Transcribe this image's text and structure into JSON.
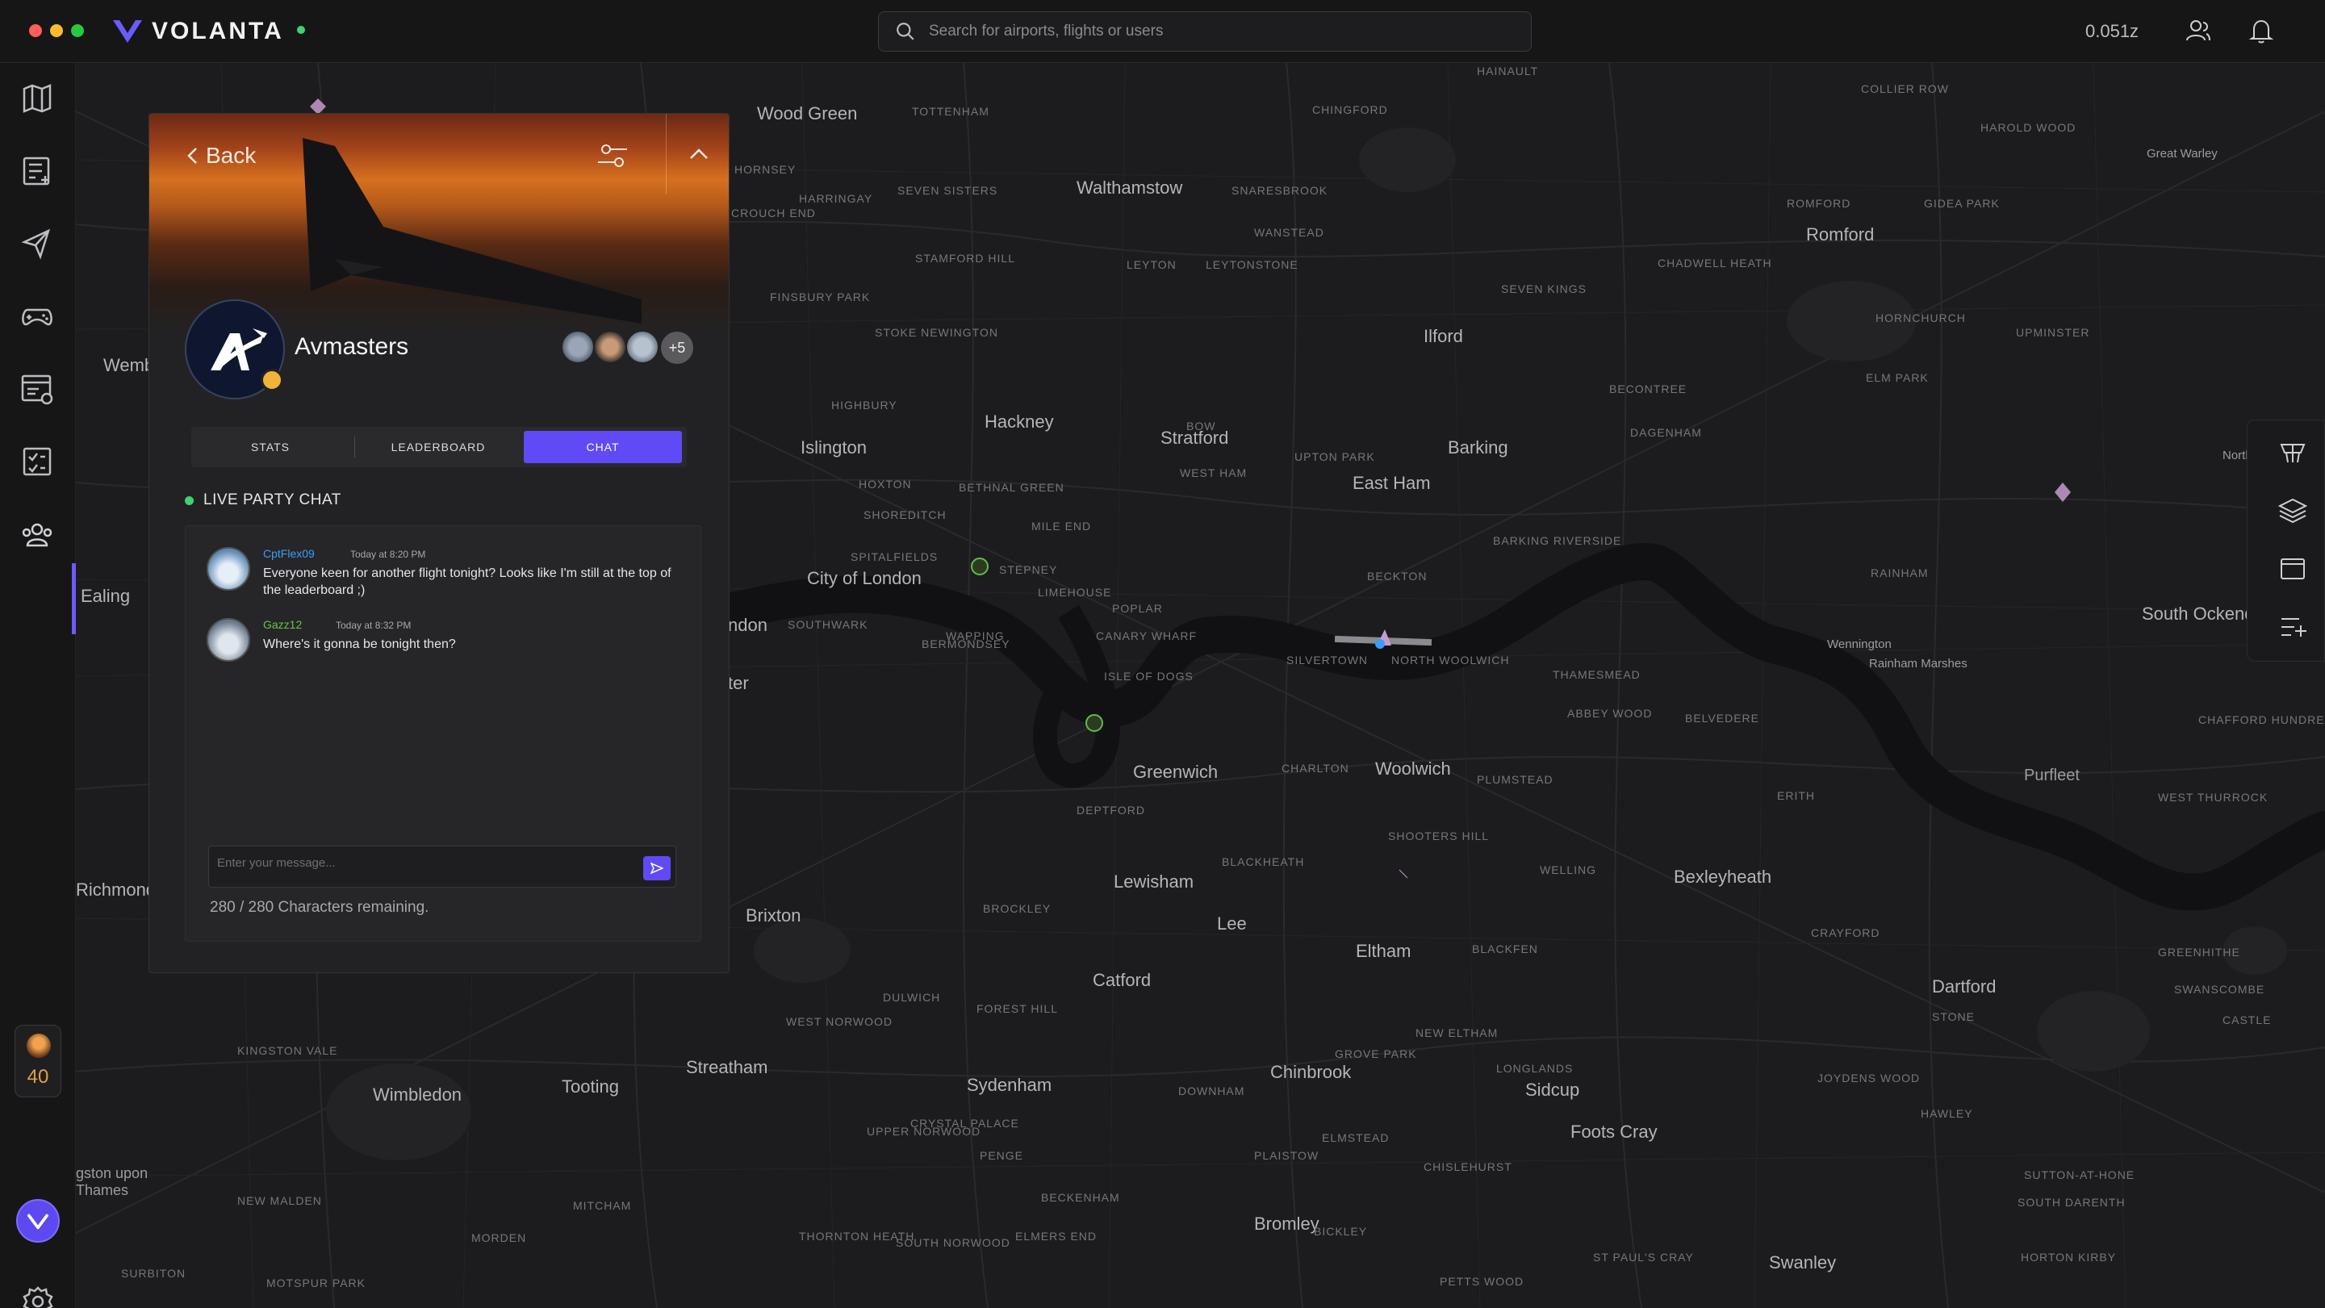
{
  "app": {
    "brand": "VOLANTA"
  },
  "search": {
    "placeholder": "Search for airports, flights or users"
  },
  "header": {
    "zulu_time": "0.051z"
  },
  "sidebar": {
    "xp_level": "40"
  },
  "map": {
    "labels_big": [
      "Walthamstow",
      "Romford",
      "Ilford",
      "Stratford",
      "Barking",
      "Hackney",
      "Islington",
      "East Ham",
      "City of London",
      "Greenwich",
      "Woolwich",
      "Lewisham",
      "Bexleyheath",
      "Brixton",
      "Catford",
      "Eltham",
      "Dartford",
      "Streatham",
      "Sydenham",
      "Wimbledon",
      "Tooting",
      "Chinbrook",
      "Sidcup",
      "Foots Cray",
      "Bromley",
      "Swanley",
      "Ealing",
      "Richmond",
      "Wood Green",
      "Lee",
      "Purfleet",
      "South Ockendon",
      "Rainham Marshes",
      "Wennington",
      "Wemb",
      "ndon",
      "ter",
      "Great Warley",
      "North Ock",
      "gston upon Thames"
    ],
    "labels_small": [
      "TOTTENHAM",
      "CHINGFORD",
      "SEVEN SISTERS",
      "STAMFORD HILL",
      "HARRINGAY",
      "STOKE NEWINGTON",
      "DAGENHAM",
      "BECONTREE",
      "SILVERTOWN",
      "NORTH WOOLWICH",
      "THAMESMEAD",
      "CANARY WHARF",
      "ISLE OF DOGS",
      "POPLAR",
      "BERMONDSEY",
      "DEPTFORD",
      "CHARLTON",
      "SHOOTERS HILL",
      "WELLING",
      "BLACKFEN",
      "HORNCHURCH",
      "UPMINSTER",
      "ELM PARK",
      "RAINHAM",
      "PLUMSTEAD",
      "ERITH",
      "BELVEDERE",
      "ABBEY WOOD",
      "CRAYFORD",
      "WEST NORWOOD",
      "DULWICH",
      "FOREST HILL",
      "PENGE",
      "BECKENHAM",
      "MITCHAM",
      "MORDEN",
      "SOUTHWARK",
      "SPITALFIELDS",
      "BOW",
      "LEYTON",
      "LEYTONSTONE",
      "WANSTEAD",
      "SNARESBROOK",
      "UPTON PARK",
      "WEST HAM",
      "BECKTON",
      "BARKING RIVERSIDE",
      "CHADWELL HEATH",
      "SEVEN KINGS",
      "HAINAULT",
      "COLLIER ROW",
      "HAROLD WOOD",
      "GIDEA PARK",
      "ROMFORD",
      "HOXTON",
      "SHOREDITCH",
      "STEPNEY",
      "LIMEHOUSE",
      "WAPPING",
      "BETHNAL GREEN",
      "MILE END",
      "HIGHBURY",
      "FINSBURY PARK",
      "HORNSEY",
      "CROUCH END",
      "KINGSTON VALE",
      "NEW MALDEN",
      "SURBITON",
      "MOTSPUR PARK",
      "THORNTON HEATH",
      "SOUTH NORWOOD",
      "ELMERS END",
      "BICKLEY",
      "ELMSTEAD",
      "PETTS WOOD",
      "ST PAUL'S CRAY",
      "CHISLEHURST",
      "LONGLANDS",
      "JOYDENS WOOD",
      "HAWLEY",
      "SOUTH DARENTH",
      "SUTTON-AT-HONE",
      "HORTON KIRBY",
      "SWANSCOMBE",
      "GREENHITHE",
      "WEST THURROCK",
      "CHAFFORD HUNDRED",
      "STONE",
      "CASTLE",
      "UPPER NORWOOD",
      "CRYSTAL PALACE",
      "PLAISTOW",
      "DOWNHAM",
      "BLACKHEATH",
      "GROVE PARK",
      "BROCKLEY",
      "NEW ELTHAM"
    ]
  },
  "panel": {
    "back_label": "Back",
    "group_name": "Avmasters",
    "members_more": "+5",
    "tabs": [
      {
        "label": "STATS"
      },
      {
        "label": "LEADERBOARD"
      },
      {
        "label": "CHAT"
      }
    ],
    "chat_title": "LIVE PARTY CHAT",
    "messages": [
      {
        "user": "CptFlex09",
        "time": "Today at 8:20 PM",
        "text": "Everyone keen for another flight tonight? Looks like I'm still at the top of the leaderboard ;)"
      },
      {
        "user": "Gazz12",
        "time": "Today at 8:32 PM",
        "text": "Where's it gonna be tonight then?"
      }
    ],
    "input_placeholder": "Enter your message...",
    "chars_remaining": "280 / 280 Characters remaining."
  },
  "colors": {
    "accent": "#5f4af6",
    "online": "#3ed36b",
    "username": "#3a9ef8",
    "level": "#e0a23c"
  },
  "icons": [
    "map-icon",
    "logbook-icon",
    "flights-icon",
    "gamepad-icon",
    "schedule-icon",
    "checklist-icon",
    "groups-icon",
    "settings-icon",
    "bell-icon",
    "users-icon",
    "search-icon",
    "filter-icon",
    "chevron-up-icon",
    "send-icon",
    "layers-icon"
  ]
}
